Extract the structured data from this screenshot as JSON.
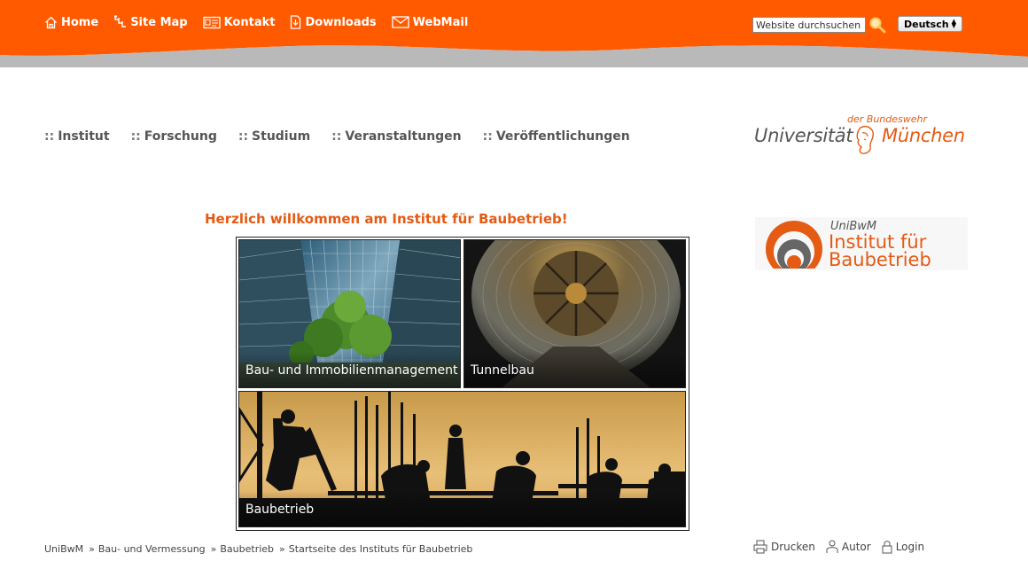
{
  "header": {
    "nav": [
      {
        "label": "Home",
        "icon": "home-icon"
      },
      {
        "label": "Site Map",
        "icon": "sitemap-icon"
      },
      {
        "label": "Kontakt",
        "icon": "contact-card-icon"
      },
      {
        "label": "Downloads",
        "icon": "download-icon"
      },
      {
        "label": "WebMail",
        "icon": "mail-icon"
      }
    ],
    "search": {
      "placeholder": "Website durchsuchen",
      "icon": "search-magnifier-icon"
    },
    "language": {
      "selected": "Deutsch"
    }
  },
  "main_nav": [
    {
      "sep": "::",
      "label": "Institut"
    },
    {
      "sep": "::",
      "label": "Forschung"
    },
    {
      "sep": "::",
      "label": "Studium"
    },
    {
      "sep": "::",
      "label": "Veranstaltungen"
    },
    {
      "sep": "::",
      "label": "Veröffentlichungen"
    }
  ],
  "university_logo": {
    "small": "der Bundeswehr",
    "left": "Universität",
    "right": "München"
  },
  "welcome": "Herzlich willkommen am Institut für Baubetrieb!",
  "tiles": [
    {
      "caption": "Bau- und Immobilienmanagement"
    },
    {
      "caption": "Tunnelbau"
    },
    {
      "caption": "Baubetrieb"
    }
  ],
  "institute_logo": {
    "abbr": "UniBwM",
    "line1": "Institut für",
    "line2": "Baubetrieb"
  },
  "breadcrumb": [
    "UniBwM",
    "Bau- und Vermessung",
    "Baubetrieb",
    "Startseite des Instituts für Baubetrieb"
  ],
  "breadcrumb_separator": "»",
  "tools": [
    {
      "label": "Drucken",
      "icon": "printer-icon"
    },
    {
      "label": "Autor",
      "icon": "person-icon"
    },
    {
      "label": "Login",
      "icon": "lock-icon"
    }
  ],
  "colors": {
    "brand_orange": "#ff5a00",
    "accent_text": "#e45b14",
    "nav_text": "#555555"
  }
}
